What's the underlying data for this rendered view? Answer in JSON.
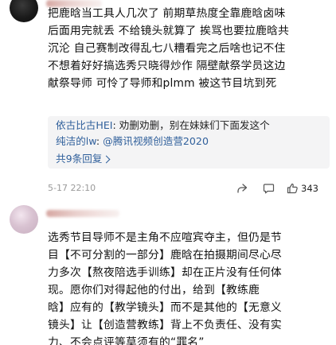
{
  "comments": [
    {
      "lines": [
        "把鹿晗当工具人几次了 前期草热度全靠鹿晗卤味",
        "后面用完就丢 不给镜头就算了 挨骂也要拉鹿晗共",
        "沉沦 自己赛制改得乱七八糟看完之后啥也记不住",
        "不想着好好搞选秀只晓得炒作 隔壁献祭学员这边",
        "献祭导师 可怜了导师和plmm 被这节目坑到死"
      ],
      "replies": [
        {
          "name": "依古比古HEI",
          "separator": ": ",
          "text": "劝删劝删，别在妹妹们下面发这个"
        },
        {
          "name": "纯洁的lw",
          "separator": ": ",
          "text": "@腾讯视频创造营2020"
        }
      ],
      "more_replies": "共9条回复",
      "timestamp": "5-17 22:10",
      "likes": "343",
      "icons": [
        "share-icon",
        "comment-icon",
        "like-icon"
      ]
    },
    {
      "lines": [
        "选秀节目导师不是主角不应喧宾夺主，但仍是节",
        "目【不可分割的一部分】鹿晗在拍摄期间尽心尽",
        "力多次【熬夜陪选手训练】却在正片没有任何体",
        "现。愿你们对得起他的付出，给到【教练鹿",
        "晗】应有的【教学镜头】而不是其他的【无意义",
        "镜头】让【创造营教练】背上不负责任、没有实",
        "力、不会点评等莫须有的“罪名”"
      ]
    }
  ],
  "colors": {
    "link": "#2f5f9b",
    "reply_bg": "#f4f4f5",
    "meta": "#9a9a9a"
  }
}
